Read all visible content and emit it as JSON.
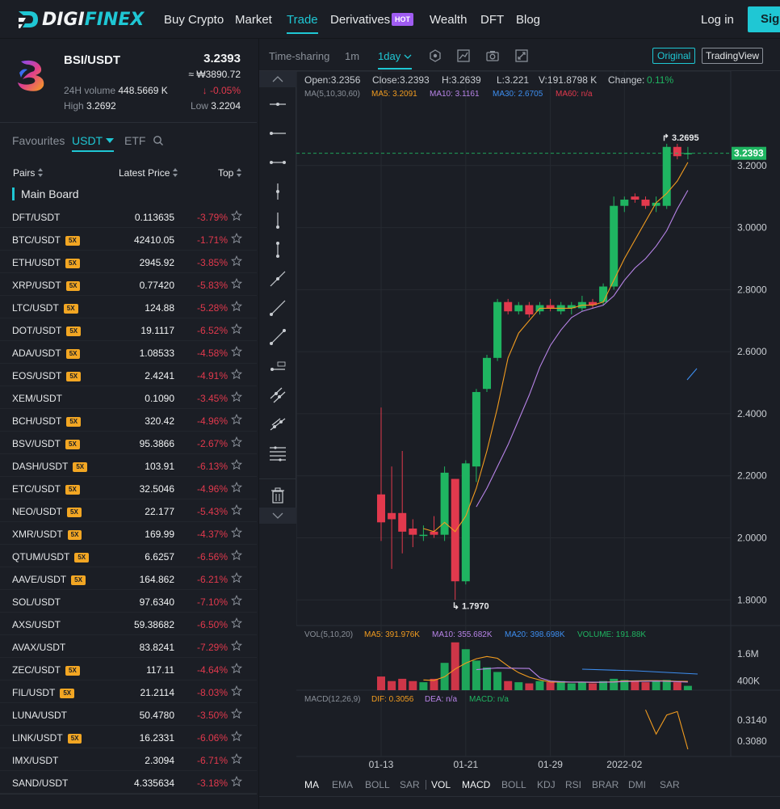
{
  "nav": {
    "logo_prefix": "DIGI",
    "logo_suffix": "FINEX",
    "items": [
      "Buy Crypto",
      "Market",
      "Trade",
      "Derivatives",
      "Wealth",
      "DFT",
      "Blog"
    ],
    "hot_badge": "HOT",
    "login": "Log in",
    "signup": "Sig"
  },
  "ticker": {
    "pair": "BSI/USDT",
    "price": "3.2393",
    "price_krw": "≈ ₩3890.72",
    "change": "↓ -0.05%",
    "volume_label": "24H volume",
    "volume": "448.5669 K",
    "high_label": "High",
    "high": "3.2692",
    "low_label": "Low",
    "low": "3.2204"
  },
  "market_tabs": {
    "favourites": "Favourites",
    "usdt": "USDT",
    "etf": "ETF"
  },
  "columns": {
    "pairs": "Pairs",
    "latest_price": "Latest Price",
    "top": "Top"
  },
  "main_board": "Main Board",
  "pairs": [
    {
      "name": "DFT/USDT",
      "lev": "",
      "price": "0.113635",
      "change": "-3.79%"
    },
    {
      "name": "BTC/USDT",
      "lev": "5X",
      "price": "42410.05",
      "change": "-1.71%"
    },
    {
      "name": "ETH/USDT",
      "lev": "5X",
      "price": "2945.92",
      "change": "-3.85%"
    },
    {
      "name": "XRP/USDT",
      "lev": "5X",
      "price": "0.77420",
      "change": "-5.83%"
    },
    {
      "name": "LTC/USDT",
      "lev": "5X",
      "price": "124.88",
      "change": "-5.28%"
    },
    {
      "name": "DOT/USDT",
      "lev": "5X",
      "price": "19.1117",
      "change": "-6.52%"
    },
    {
      "name": "ADA/USDT",
      "lev": "5X",
      "price": "1.08533",
      "change": "-4.58%"
    },
    {
      "name": "EOS/USDT",
      "lev": "5X",
      "price": "2.4241",
      "change": "-4.91%"
    },
    {
      "name": "XEM/USDT",
      "lev": "",
      "price": "0.1090",
      "change": "-3.45%"
    },
    {
      "name": "BCH/USDT",
      "lev": "5X",
      "price": "320.42",
      "change": "-4.96%"
    },
    {
      "name": "BSV/USDT",
      "lev": "5X",
      "price": "95.3866",
      "change": "-2.67%"
    },
    {
      "name": "DASH/USDT",
      "lev": "5X",
      "price": "103.91",
      "change": "-6.13%"
    },
    {
      "name": "ETC/USDT",
      "lev": "5X",
      "price": "32.5046",
      "change": "-4.96%"
    },
    {
      "name": "NEO/USDT",
      "lev": "5X",
      "price": "22.177",
      "change": "-5.43%"
    },
    {
      "name": "XMR/USDT",
      "lev": "5X",
      "price": "169.99",
      "change": "-4.37%"
    },
    {
      "name": "QTUM/USDT",
      "lev": "5X",
      "price": "6.6257",
      "change": "-6.56%"
    },
    {
      "name": "AAVE/USDT",
      "lev": "5X",
      "price": "164.862",
      "change": "-6.21%"
    },
    {
      "name": "SOL/USDT",
      "lev": "",
      "price": "97.6340",
      "change": "-7.10%"
    },
    {
      "name": "AXS/USDT",
      "lev": "",
      "price": "59.38682",
      "change": "-6.50%"
    },
    {
      "name": "AVAX/USDT",
      "lev": "",
      "price": "83.8241",
      "change": "-7.29%"
    },
    {
      "name": "ZEC/USDT",
      "lev": "5X",
      "price": "117.11",
      "change": "-4.64%"
    },
    {
      "name": "FIL/USDT",
      "lev": "5X",
      "price": "21.2114",
      "change": "-8.03%"
    },
    {
      "name": "LUNA/USDT",
      "lev": "",
      "price": "50.4780",
      "change": "-3.50%"
    },
    {
      "name": "LINK/USDT",
      "lev": "5X",
      "price": "16.2331",
      "change": "-6.06%"
    },
    {
      "name": "IMX/USDT",
      "lev": "",
      "price": "2.3094",
      "change": "-6.71%"
    },
    {
      "name": "SAND/USDT",
      "lev": "",
      "price": "4.335634",
      "change": "-3.18%"
    }
  ],
  "toolbar": {
    "time_sharing": "Time-sharing",
    "m1": "1m",
    "day1": "1day",
    "original": "Original",
    "tradingview": "TradingView"
  },
  "colors": {
    "accent": "#1fc7d4",
    "up": "#1fb561",
    "down": "#e2394d",
    "bg": "#1b1e25"
  },
  "chart_data": {
    "type": "candlestick",
    "info": {
      "open": "Open:3.2356",
      "close": "Close:3.2393",
      "high": "H:3.2639",
      "low": "L:3.221",
      "vol": "V:191.8798 K",
      "change_label": "Change:",
      "change": "0.11%",
      "ma_label": "MA(5,10,30,60)",
      "ma5": "MA5: 3.2091",
      "ma10": "MA10: 3.1161",
      "ma30": "MA30: 2.6705",
      "ma60": "MA60: n/a"
    },
    "last_price": "3.2393",
    "max_label": "3.2695",
    "min_label": "1.7970",
    "y_ticks": [
      "3.2000",
      "3.0000",
      "2.8000",
      "2.6000",
      "2.4000",
      "2.2000",
      "2.0000",
      "1.8000"
    ],
    "y_tick_values": [
      3.2,
      3.0,
      2.8,
      2.6,
      2.4,
      2.2,
      2.0,
      1.8
    ],
    "ylim": [
      1.72,
      3.4
    ],
    "x_ticks": [
      "01-13",
      "01-21",
      "01-29",
      "2022-02"
    ],
    "x_tick_index": [
      0,
      8,
      16,
      23
    ],
    "candles": [
      {
        "o": 2.14,
        "h": 2.42,
        "l": 1.99,
        "c": 2.05
      },
      {
        "o": 2.08,
        "h": 2.23,
        "l": 1.9,
        "c": 2.06
      },
      {
        "o": 2.08,
        "h": 2.28,
        "l": 1.95,
        "c": 2.02
      },
      {
        "o": 2.03,
        "h": 2.06,
        "l": 1.97,
        "c": 2.01
      },
      {
        "o": 2.01,
        "h": 2.04,
        "l": 1.99,
        "c": 2.01
      },
      {
        "o": 2.02,
        "h": 2.07,
        "l": 2.0,
        "c": 2.01
      },
      {
        "o": 2.01,
        "h": 2.23,
        "l": 1.99,
        "c": 2.21
      },
      {
        "o": 2.19,
        "h": 2.19,
        "l": 1.8,
        "c": 1.86
      },
      {
        "o": 1.86,
        "h": 2.25,
        "l": 1.85,
        "c": 2.24
      },
      {
        "o": 2.23,
        "h": 2.48,
        "l": 2.18,
        "c": 2.47
      },
      {
        "o": 2.48,
        "h": 2.59,
        "l": 2.47,
        "c": 2.58
      },
      {
        "o": 2.58,
        "h": 2.77,
        "l": 2.57,
        "c": 2.76
      },
      {
        "o": 2.76,
        "h": 2.77,
        "l": 2.72,
        "c": 2.73
      },
      {
        "o": 2.73,
        "h": 2.76,
        "l": 2.72,
        "c": 2.75
      },
      {
        "o": 2.75,
        "h": 2.76,
        "l": 2.71,
        "c": 2.72
      },
      {
        "o": 2.73,
        "h": 2.76,
        "l": 2.72,
        "c": 2.75
      },
      {
        "o": 2.75,
        "h": 2.77,
        "l": 2.73,
        "c": 2.74
      },
      {
        "o": 2.73,
        "h": 2.76,
        "l": 2.72,
        "c": 2.75
      },
      {
        "o": 2.74,
        "h": 2.76,
        "l": 2.72,
        "c": 2.75
      },
      {
        "o": 2.74,
        "h": 2.78,
        "l": 2.73,
        "c": 2.76
      },
      {
        "o": 2.76,
        "h": 2.77,
        "l": 2.74,
        "c": 2.75
      },
      {
        "o": 2.76,
        "h": 2.82,
        "l": 2.75,
        "c": 2.81
      },
      {
        "o": 2.81,
        "h": 3.1,
        "l": 2.8,
        "c": 3.07
      },
      {
        "o": 3.07,
        "h": 3.1,
        "l": 3.05,
        "c": 3.09
      },
      {
        "o": 3.1,
        "h": 3.11,
        "l": 3.08,
        "c": 3.09
      },
      {
        "o": 3.09,
        "h": 3.1,
        "l": 3.06,
        "c": 3.07
      },
      {
        "o": 3.07,
        "h": 3.1,
        "l": 3.05,
        "c": 3.08
      },
      {
        "o": 3.07,
        "h": 3.27,
        "l": 3.06,
        "c": 3.26
      },
      {
        "o": 3.26,
        "h": 3.27,
        "l": 3.22,
        "c": 3.23
      },
      {
        "o": 3.24,
        "h": 3.26,
        "l": 3.22,
        "c": 3.24
      }
    ],
    "ma5": [
      null,
      null,
      null,
      null,
      2.03,
      2.02,
      2.05,
      2.02,
      2.07,
      2.16,
      2.28,
      2.42,
      2.58,
      2.66,
      2.7,
      2.74,
      2.74,
      2.74,
      2.74,
      2.75,
      2.75,
      2.76,
      2.83,
      2.9,
      2.96,
      3.02,
      3.08,
      3.11,
      3.15,
      3.21
    ],
    "ma10": [
      null,
      null,
      null,
      null,
      null,
      null,
      null,
      null,
      null,
      2.1,
      2.16,
      2.23,
      2.3,
      2.38,
      2.46,
      2.55,
      2.62,
      2.67,
      2.71,
      2.73,
      2.74,
      2.75,
      2.78,
      2.83,
      2.87,
      2.9,
      2.94,
      2.99,
      3.06,
      3.12
    ],
    "volume_info": {
      "label": "VOL(5,10,20)",
      "ma5": "MA5: 391.976K",
      "ma10": "MA10: 355.682K",
      "ma20": "MA20: 398.698K",
      "volume": "VOLUME: 191.88K",
      "y_ticks": [
        "1.6M",
        "400K"
      ],
      "y_tick_values": [
        1600,
        400
      ],
      "ylim": [
        0,
        2200
      ]
    },
    "volumes": [
      600,
      400,
      500,
      400,
      350,
      500,
      1200,
      2100,
      1800,
      1300,
      1000,
      800,
      400,
      350,
      300,
      400,
      350,
      400,
      300,
      350,
      300,
      400,
      500,
      450,
      400,
      350,
      400,
      450,
      350,
      191
    ],
    "vol_ma5": [
      null,
      null,
      null,
      null,
      450,
      430,
      590,
      930,
      1190,
      1380,
      1480,
      1400,
      1060,
      770,
      570,
      450,
      360,
      360,
      350,
      360,
      340,
      350,
      370,
      400,
      410,
      420,
      420,
      410,
      390,
      392
    ],
    "vol_ma10": [
      null,
      null,
      null,
      null,
      null,
      null,
      null,
      null,
      null,
      900,
      940,
      980,
      970,
      960,
      955,
      545,
      400,
      370,
      360,
      360,
      350,
      350,
      360,
      380,
      390,
      395,
      400,
      390,
      375,
      356
    ],
    "macd_info": {
      "label": "MACD(12,26,9)",
      "dif": "DIF: 0.3056",
      "dea": "DEA: n/a",
      "macd": "MACD: n/a",
      "y_ticks": [
        "0.3140",
        "0.3080"
      ],
      "y_tick_values": [
        0.314,
        0.308
      ],
      "ylim": [
        0.304,
        0.318
      ]
    },
    "dif": [
      null,
      null,
      null,
      null,
      null,
      null,
      null,
      null,
      null,
      null,
      null,
      null,
      null,
      null,
      null,
      null,
      null,
      null,
      null,
      null,
      null,
      null,
      null,
      null,
      null,
      0.317,
      0.31,
      0.3155,
      0.3165,
      0.3056
    ],
    "bottom_tabs": [
      "MA",
      "EMA",
      "BOLL",
      "SAR",
      "VOL",
      "MACD",
      "BOLL",
      "KDJ",
      "RSI",
      "BRAR",
      "DMI",
      "SAR"
    ]
  }
}
